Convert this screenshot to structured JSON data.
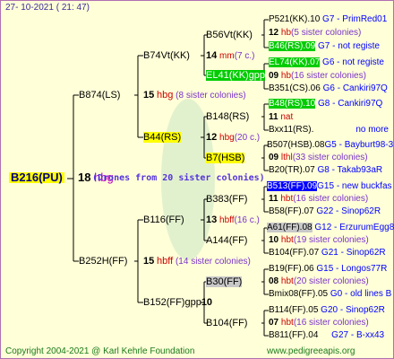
{
  "header": {
    "date": "27- 10-2021 ( 21: 47)"
  },
  "footer": {
    "copyright": "Copyright 2004-2021 @ Karl Kehrle Foundation",
    "site": "www.pedigreeapis.org"
  },
  "root": {
    "id": "B216(PU)",
    "year": "18",
    "code": "hbg",
    "note": "(Drones from 20 sister colonies)"
  },
  "gen1": {
    "a": {
      "id": "B874(LS)",
      "year": "15",
      "code": "hbg",
      "note": "(8 sister colonies)"
    },
    "b": {
      "id": "B252H(FF)",
      "year": "15",
      "code": "hbff",
      "note": "(14 sister colonies)"
    }
  },
  "gen2": {
    "a1": {
      "id": "B74Vt(KK)",
      "year": "14",
      "code": "mm",
      "note": "(7 c.)"
    },
    "a2": {
      "id": "B44(RS)",
      "year": "12",
      "code": "hbg",
      "note": "(20 c.)"
    },
    "b1": {
      "id": "B116(FF)",
      "year": "13",
      "code": "hbff",
      "note": "(16 c.)"
    },
    "b2": {
      "id": "B152(FF)gpp",
      "year": "10",
      "code": "",
      "note": ""
    }
  },
  "gen3": {
    "a1a": "B56Vt(KK)",
    "a1b": "EL41(KK)gpp",
    "a2a": "B148(RS)",
    "a2b": "B7(HSB)",
    "b1a": "B383(FF)",
    "b1b": "A144(FF)",
    "b2a": "B30(FF)",
    "b2b": "B104(FF)"
  },
  "gen4": [
    {
      "id": "P521(KK).10",
      "info": "G7 - PrimRed01"
    },
    {
      "year": "12",
      "code": "hb",
      "note": "(5 sister colonies)"
    },
    {
      "id": "B46(RS).09",
      "info": "G7 - not registe"
    },
    {
      "id": "EL74(KK).07",
      "info": "G6 - not registe"
    },
    {
      "year": "09",
      "code": "hb",
      "note": "(16 sister colonies)"
    },
    {
      "id": "B351(CS).06",
      "info": "G6 - Cankiri97Q"
    },
    {
      "id": "B48(RS).10",
      "info": "G8 - Cankiri97Q"
    },
    {
      "year": "11",
      "code": "nat",
      "note": ""
    },
    {
      "id": "Bxx11(RS).",
      "info": "no more"
    },
    {
      "id": "B507(HSB).08",
      "info": "G5 - Bayburt98-3"
    },
    {
      "year": "09",
      "code": "lthl",
      "note": "(33 sister colonies)"
    },
    {
      "id": "B20(TR).07",
      "info": "G8 - Takab93aR"
    },
    {
      "id": "B513(FF).09",
      "info": "G15 - new buckfas"
    },
    {
      "year": "11",
      "code": "hbt",
      "note": "(16 sister colonies)"
    },
    {
      "id": "B58(FF).07",
      "info": "G22 - Sinop62R"
    },
    {
      "id": "A61(FF).08",
      "info": "G12 - ErzurumEgg8"
    },
    {
      "year": "10",
      "code": "hbt",
      "note": "(19 sister colonies)"
    },
    {
      "id": "B104(FF).07",
      "info": "G21 - Sinop62R"
    },
    {
      "id": "B19(FF).06",
      "info": "G15 - Longos77R"
    },
    {
      "year": "08",
      "code": "hbt",
      "note": "(20 sister colonies)"
    },
    {
      "id": "Bmix08(FF).05",
      "info": "G0 - old lines B"
    },
    {
      "id": "B114(FF).05",
      "info": "G20 - Sinop62R"
    },
    {
      "year": "07",
      "code": "hbt",
      "note": "(16 sister colonies)"
    },
    {
      "id": "B811(FF).04",
      "info": "G27 - B-xx43"
    }
  ]
}
